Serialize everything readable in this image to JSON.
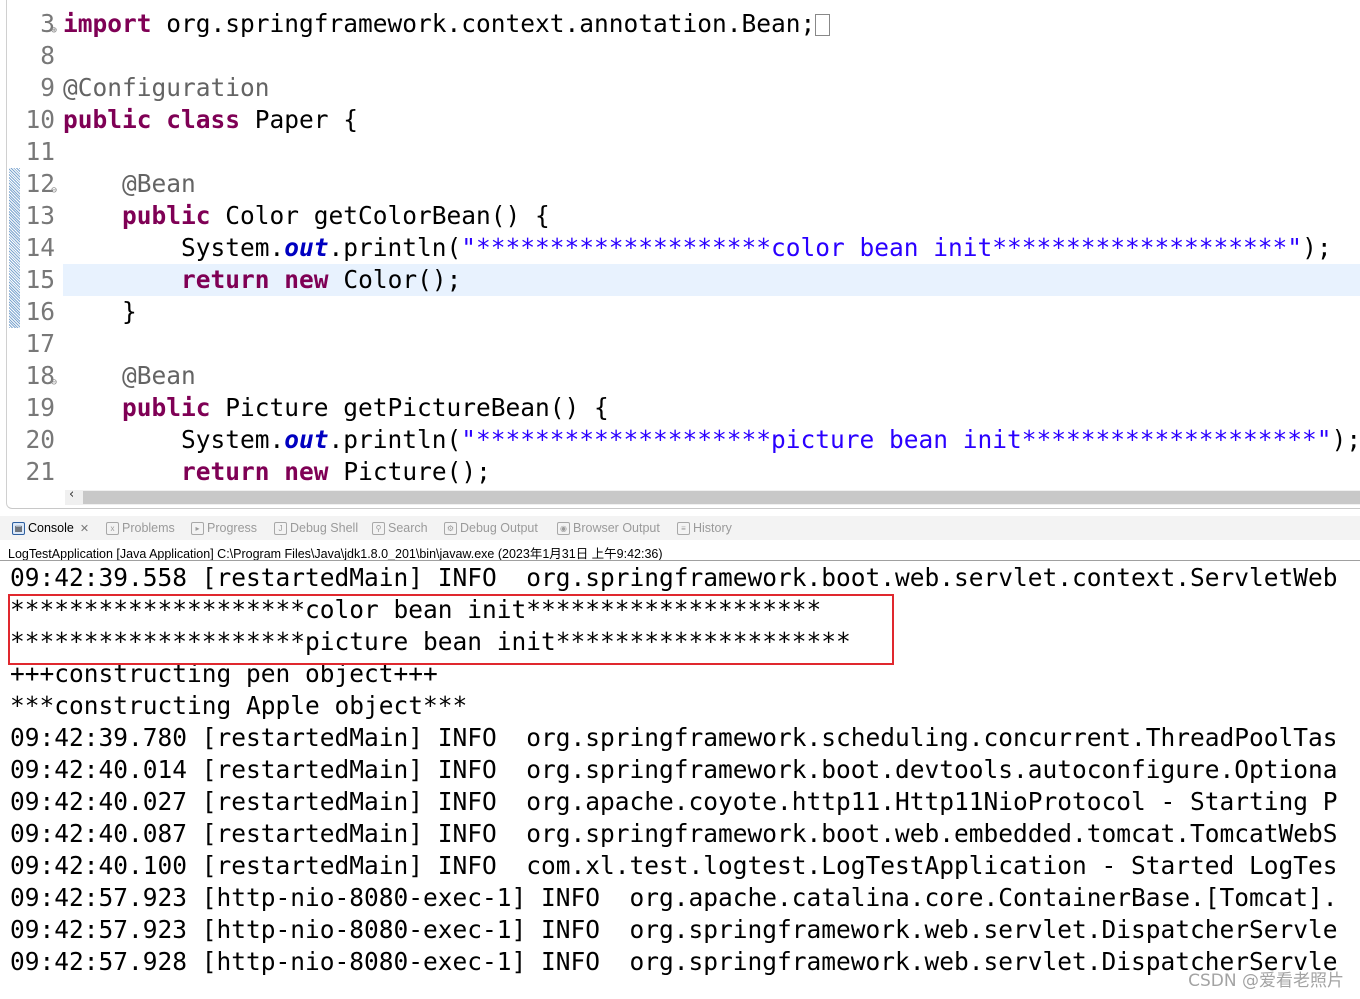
{
  "editor": {
    "current_line": "15",
    "lines": [
      {
        "num": "3",
        "fold": "⊕",
        "tokens": [
          {
            "t": "import",
            "c": "kw"
          },
          {
            "t": " org.springframework.context.annotation.Bean;",
            "c": ""
          }
        ],
        "box": true
      },
      {
        "num": "8",
        "tokens": []
      },
      {
        "num": "9",
        "tokens": [
          {
            "t": "@Configuration",
            "c": "ann"
          }
        ]
      },
      {
        "num": "10",
        "tokens": [
          {
            "t": "public",
            "c": "kw"
          },
          {
            "t": " ",
            "c": ""
          },
          {
            "t": "class",
            "c": "kw"
          },
          {
            "t": " Paper {",
            "c": ""
          }
        ]
      },
      {
        "num": "11",
        "tokens": []
      },
      {
        "num": "12",
        "fold": "⊖",
        "tokens": [
          {
            "t": "    @Bean",
            "c": "ann"
          }
        ]
      },
      {
        "num": "13",
        "tokens": [
          {
            "t": "    ",
            "c": ""
          },
          {
            "t": "public",
            "c": "kw"
          },
          {
            "t": " Color getColorBean() {",
            "c": ""
          }
        ]
      },
      {
        "num": "14",
        "tokens": [
          {
            "t": "        System.",
            "c": ""
          },
          {
            "t": "out",
            "c": "field"
          },
          {
            "t": ".println(",
            "c": ""
          },
          {
            "t": "\"********************color bean init********************\"",
            "c": "str"
          },
          {
            "t": ");",
            "c": ""
          }
        ]
      },
      {
        "num": "15",
        "tokens": [
          {
            "t": "        ",
            "c": ""
          },
          {
            "t": "return",
            "c": "kw"
          },
          {
            "t": " ",
            "c": ""
          },
          {
            "t": "new",
            "c": "kw"
          },
          {
            "t": " Color();",
            "c": ""
          }
        ]
      },
      {
        "num": "16",
        "tokens": [
          {
            "t": "    }",
            "c": ""
          }
        ]
      },
      {
        "num": "17",
        "tokens": []
      },
      {
        "num": "18",
        "fold": "⊖",
        "tokens": [
          {
            "t": "    @Bean",
            "c": "ann"
          }
        ]
      },
      {
        "num": "19",
        "tokens": [
          {
            "t": "    ",
            "c": ""
          },
          {
            "t": "public",
            "c": "kw"
          },
          {
            "t": " Picture getPictureBean() {",
            "c": ""
          }
        ]
      },
      {
        "num": "20",
        "tokens": [
          {
            "t": "        System.",
            "c": ""
          },
          {
            "t": "out",
            "c": "field"
          },
          {
            "t": ".println(",
            "c": ""
          },
          {
            "t": "\"********************picture bean init********************\"",
            "c": "str"
          },
          {
            "t": ");",
            "c": ""
          }
        ]
      },
      {
        "num": "21",
        "tokens": [
          {
            "t": "        ",
            "c": ""
          },
          {
            "t": "return",
            "c": "kw"
          },
          {
            "t": " ",
            "c": ""
          },
          {
            "t": "new",
            "c": "kw"
          },
          {
            "t": " Picture();",
            "c": ""
          }
        ]
      }
    ]
  },
  "scroll_left": "‹",
  "tabs": [
    {
      "label": "Console",
      "icon": "console-icon",
      "glyph": "▤",
      "active": true,
      "close": "✕"
    },
    {
      "label": "Problems",
      "icon": "problems-icon",
      "glyph": "x"
    },
    {
      "label": "Progress",
      "icon": "progress-icon",
      "glyph": "▸"
    },
    {
      "label": "Debug Shell",
      "icon": "debug-shell-icon",
      "glyph": "J"
    },
    {
      "label": "Search",
      "icon": "search-icon",
      "glyph": "⚲"
    },
    {
      "label": "Debug Output",
      "icon": "debug-output-icon",
      "glyph": "⚙"
    },
    {
      "label": "Browser Output",
      "icon": "browser-output-icon",
      "glyph": "◉"
    },
    {
      "label": "History",
      "icon": "history-icon",
      "glyph": "≡"
    }
  ],
  "console": {
    "process": "LogTestApplication [Java Application] C:\\Program Files\\Java\\jdk1.8.0_201\\bin\\javaw.exe (2023年1月31日 上午9:42:36)",
    "lines": [
      "09:42:39.558 [restartedMain] INFO  org.springframework.boot.web.servlet.context.ServletWeb",
      "********************color bean init********************",
      "********************picture bean init********************",
      "+++constructing pen object+++",
      "***constructing Apple object***",
      "09:42:39.780 [restartedMain] INFO  org.springframework.scheduling.concurrent.ThreadPoolTas",
      "09:42:40.014 [restartedMain] INFO  org.springframework.boot.devtools.autoconfigure.Optiona",
      "09:42:40.027 [restartedMain] INFO  org.apache.coyote.http11.Http11NioProtocol - Starting P",
      "09:42:40.087 [restartedMain] INFO  org.springframework.boot.web.embedded.tomcat.TomcatWebS",
      "09:42:40.100 [restartedMain] INFO  com.xl.test.logtest.LogTestApplication - Started LogTes",
      "09:42:57.923 [http-nio-8080-exec-1] INFO  org.apache.catalina.core.ContainerBase.[Tomcat].",
      "09:42:57.923 [http-nio-8080-exec-1] INFO  org.springframework.web.servlet.DispatcherServle",
      "09:42:57.928 [http-nio-8080-exec-1] INFO  org.springframework.web.servlet.DispatcherServle"
    ]
  },
  "watermark": "CSDN @爱看老照片",
  "colors": {
    "keyword": "#7f0055",
    "string": "#2a00ff",
    "annotation": "#646464",
    "highlight_box": "#e0282e",
    "current_line": "#e8f2fe"
  }
}
